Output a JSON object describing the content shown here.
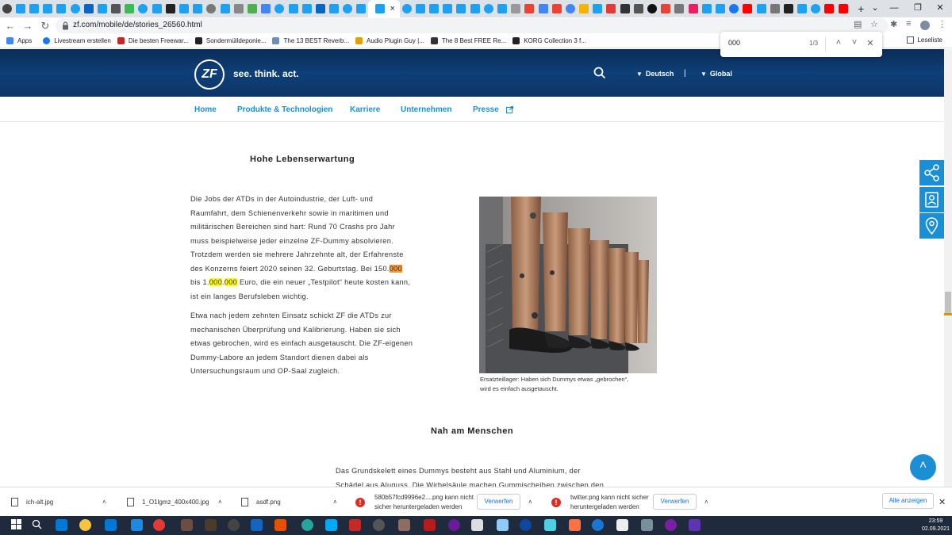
{
  "colors": {
    "accent": "#1a8fd6",
    "header": "#0e3f78",
    "highlight": "#ffff00",
    "find_active": "#ff9632"
  },
  "browser": {
    "tab_count_icons": 62,
    "url": "zf.com/mobile/de/stories_26560.html",
    "close_tab": "×",
    "new_tab": "+",
    "bookmarks": [
      {
        "label": "Apps",
        "icon": "apps-grid-icon"
      },
      {
        "label": "Livestream erstellen",
        "icon": "facebook-icon"
      },
      {
        "label": "Die besten Freewar...",
        "icon": "star-icon"
      },
      {
        "label": "Sondermülldeponie...",
        "icon": "wikipedia-icon"
      },
      {
        "label": "The 13 BEST Reverb...",
        "icon": "plugin-icon"
      },
      {
        "label": "Audio Plugin Guy |...",
        "icon": "audio-icon"
      },
      {
        "label": "The 8 Best FREE Re...",
        "icon": "moon-icon"
      },
      {
        "label": "KORG Collection 3 f...",
        "icon": "korg-icon"
      }
    ],
    "reading_list": "Leseliste",
    "find": {
      "query": "000",
      "count": "1/3"
    }
  },
  "site": {
    "logo": "ZF",
    "slogan": "see. think. act.",
    "lang": "Deutsch",
    "separator": "|",
    "region": "Global",
    "nav": [
      "Home",
      "Produkte & Technologien",
      "Karriere",
      "Unternehmen",
      "Presse"
    ]
  },
  "article": {
    "heading1": "Hohe Lebenserwartung",
    "para1_lines": [
      "Die Jobs der ATDs in der Autoindustrie, der Luft- und",
      "Raumfahrt, dem Schienenverkehr sowie in maritimen und",
      "militärischen Bereichen sind hart: Rund 70 Crashs pro Jahr",
      "muss beispielweise jeder einzelne ZF-Dummy absolvieren.",
      "Trotzdem werden sie mehrere Jahrzehnte alt, der Erfahrenste",
      "des Konzerns feiert 2020 seinen 32. Geburtstag. Bei 150."
    ],
    "para1_hl1": "000",
    "para1_l7a": "bis 1.",
    "para1_hl2": "000",
    "para1_l7b": ".",
    "para1_hl3": "000",
    "para1_l7c": " Euro, die ein neuer „Testpilot“ heute kosten kann,",
    "para1_l8": "ist ein langes Berufsleben wichtig.",
    "para2_lines": [
      "Etwa nach jedem zehnten Einsatz schickt ZF die ATDs zur",
      "mechanischen Überprüfung und Kalibrierung. Haben sie sich",
      "etwas gebrochen, wird es einfach ausgetauscht. Die ZF-eigenen",
      "Dummy-Labore an jedem Standort dienen dabei als",
      "Untersuchungsraum und OP-Saal zugleich."
    ],
    "caption_lines": [
      "Ersatzteillager: Haben sich Dummys etwas „gebrochen“,",
      "wird es einfach ausgetauscht."
    ],
    "heading2": "Nah am Menschen",
    "para3_lines": [
      "Das Grundskelett eines Dummys besteht aus Stahl und Aluminium, der",
      "Schädel aus Aluguss. Die Wirbelsäule machen Gummischeiben zwischen den"
    ]
  },
  "downloads": {
    "items": [
      {
        "name": "ich-alt.jpg"
      },
      {
        "name": "1_O1lgmz_400x400.jpg"
      },
      {
        "name": "asdf.png"
      }
    ],
    "warnings": [
      {
        "line1": "580b57fcd9996e2....png kann nicht",
        "line2": "sicher heruntergeladen werden",
        "button": "Verwerfen"
      },
      {
        "line1": "twitter.png kann nicht sicher",
        "line2": "heruntergeladen werden",
        "button": "Verwerfen"
      }
    ],
    "show_all": "Alle anzeigen"
  },
  "taskbar": {
    "time": "23:59",
    "date": "02.09.2021"
  }
}
